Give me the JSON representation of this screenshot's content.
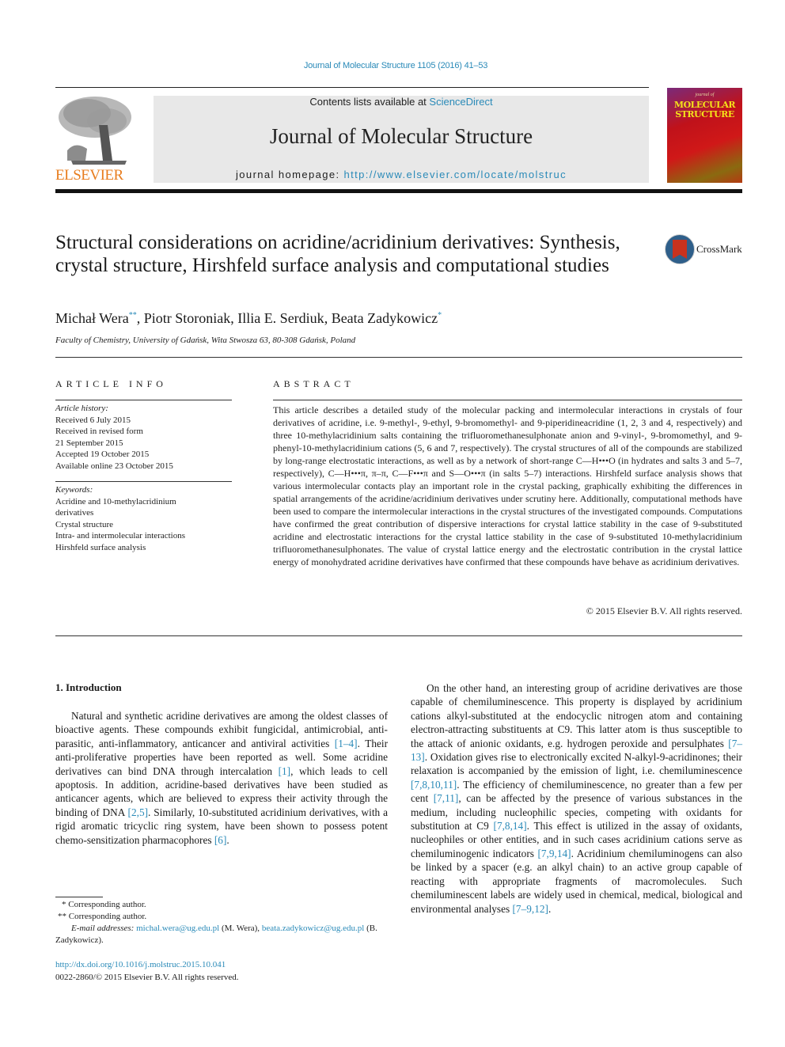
{
  "header": {
    "journal_ref": "Journal of Molecular Structure 1105 (2016) 41–53",
    "contents_prefix": "Contents lists available at ",
    "contents_link": "ScienceDirect",
    "journal_name": "Journal of Molecular Structure",
    "homepage_prefix": "journal homepage: ",
    "homepage_url": "http://www.elsevier.com/locate/molstruc",
    "publisher_logo": "ELSEVIER",
    "cover_pre": "journal of",
    "cover_title_1": "MOLECULAR",
    "cover_title_2": "STRUCTURE",
    "crossmark_label": "CrossMark"
  },
  "article": {
    "title": "Structural considerations on acridine/acridinium derivatives: Synthesis, crystal structure, Hirshfeld surface analysis and computational studies",
    "authors": [
      {
        "name": "Michał Wera",
        "mark": "**"
      },
      {
        "name": "Piotr Storoniak",
        "mark": ""
      },
      {
        "name": "Illia E. Serdiuk",
        "mark": ""
      },
      {
        "name": "Beata Zadykowicz",
        "mark": "*"
      }
    ],
    "affiliation": "Faculty of Chemistry, University of Gdańsk, Wita Stwosza 63, 80-308 Gdańsk, Poland"
  },
  "article_info": {
    "heading": "ARTICLE INFO",
    "history_label": "Article history:",
    "history": [
      "Received 6 July 2015",
      "Received in revised form",
      "21 September 2015",
      "Accepted 19 October 2015",
      "Available online 23 October 2015"
    ],
    "keywords_label": "Keywords:",
    "keywords": [
      "Acridine and 10-methylacridinium derivatives",
      "Crystal structure",
      "Intra- and intermolecular interactions",
      "Hirshfeld surface analysis"
    ]
  },
  "abstract": {
    "heading": "ABSTRACT",
    "text": "This article describes a detailed study of the molecular packing and intermolecular interactions in crystals of four derivatives of acridine, i.e. 9-methyl-, 9-ethyl, 9-bromomethyl- and 9-piperidineacridine (1, 2, 3 and 4, respectively) and three 10-methylacridinium salts containing the trifluoromethanesulphonate anion and 9-vinyl-, 9-bromomethyl, and 9-phenyl-10-methylacridinium cations (5, 6 and 7, respectively). The crystal structures of all of the compounds are stabilized by long-range electrostatic interactions, as well as by a network of short-range C—H•••O (in hydrates and salts 3 and 5–7, respectively), C—H•••π, π–π, C—F•••π and S—O•••π (in salts 5–7) interactions. Hirshfeld surface analysis shows that various intermolecular contacts play an important role in the crystal packing, graphically exhibiting the differences in spatial arrangements of the acridine/acridinium derivatives under scrutiny here. Additionally, computational methods have been used to compare the intermolecular interactions in the crystal structures of the investigated compounds. Computations have confirmed the great contribution of dispersive interactions for crystal lattice stability in the case of 9-substituted acridine and electrostatic interactions for the crystal lattice stability in the case of 9-substituted 10-methylacridinium trifluoromethanesulphonates. The value of crystal lattice energy and the electrostatic contribution in the crystal lattice energy of monohydrated acridine derivatives have confirmed that these compounds have behave as acridinium derivatives.",
    "copyright": "© 2015 Elsevier B.V. All rights reserved."
  },
  "introduction": {
    "heading": "1.  Introduction",
    "col1": [
      {
        "t": "Natural and synthetic acridine derivatives are among the oldest classes of bioactive agents. These compounds exhibit fungicidal, antimicrobial, anti-parasitic, anti-inflammatory, anticancer and antiviral activities "
      },
      {
        "ref": "[1–4]"
      },
      {
        "t": ". Their anti-proliferative properties have been reported as well. Some acridine derivatives can bind DNA through intercalation "
      },
      {
        "ref": "[1]"
      },
      {
        "t": ", which leads to cell apoptosis. In addition, acridine-based derivatives have been studied as anticancer agents, which are believed to express their activity through the binding of DNA "
      },
      {
        "ref": "[2,5]"
      },
      {
        "t": ". Similarly, 10-substituted acridinium derivatives, with a rigid aromatic tricyclic ring system, have been shown to possess potent chemo-sensitization pharmacophores "
      },
      {
        "ref": "[6]"
      },
      {
        "t": "."
      }
    ],
    "col2": [
      {
        "t": "On the other hand, an interesting group of acridine derivatives are those capable of chemiluminescence. This property is displayed by acridinium cations alkyl-substituted at the endocyclic nitrogen atom and containing electron-attracting substituents at C9. This latter atom is thus susceptible to the attack of anionic oxidants, e.g. hydrogen peroxide and persulphates "
      },
      {
        "ref": "[7–13]"
      },
      {
        "t": ". Oxidation gives rise to electronically excited N-alkyl-9-acridinones; their relaxation is accompanied by the emission of light, i.e. chemiluminescence "
      },
      {
        "ref": "[7,8,10,11]"
      },
      {
        "t": ". The efficiency of chemiluminescence, no greater than a few per cent "
      },
      {
        "ref": "[7,11]"
      },
      {
        "t": ", can be affected by the presence of various substances in the medium, including nucleophilic species, competing with oxidants for substitution at C9 "
      },
      {
        "ref": "[7,8,14]"
      },
      {
        "t": ". This effect is utilized in the assay of oxidants, nucleophiles or other entities, and in such cases acridinium cations serve as chemiluminogenic indicators "
      },
      {
        "ref": "[7,9,14]"
      },
      {
        "t": ". Acridinium chemiluminogens can also be linked by a spacer (e.g. an alkyl chain) to an active group capable of reacting with appropriate fragments of macromolecules. Such chemiluminescent labels are widely used in chemical, medical, biological and environmental analyses "
      },
      {
        "ref": "[7–9,12]"
      },
      {
        "t": "."
      }
    ]
  },
  "footnotes": {
    "fn1": "* Corresponding author.",
    "fn2": "** Corresponding author.",
    "email_label": "E-mail addresses:",
    "email1": "michal.wera@ug.edu.pl",
    "email1_owner": " (M. Wera), ",
    "email2": "beata.zadykowicz@ug.edu.pl",
    "email2_owner": " (B. Zadykowicz).",
    "doi": "http://dx.doi.org/10.1016/j.molstruc.2015.10.041",
    "issn": "0022-2860/© 2015 Elsevier B.V. All rights reserved."
  }
}
